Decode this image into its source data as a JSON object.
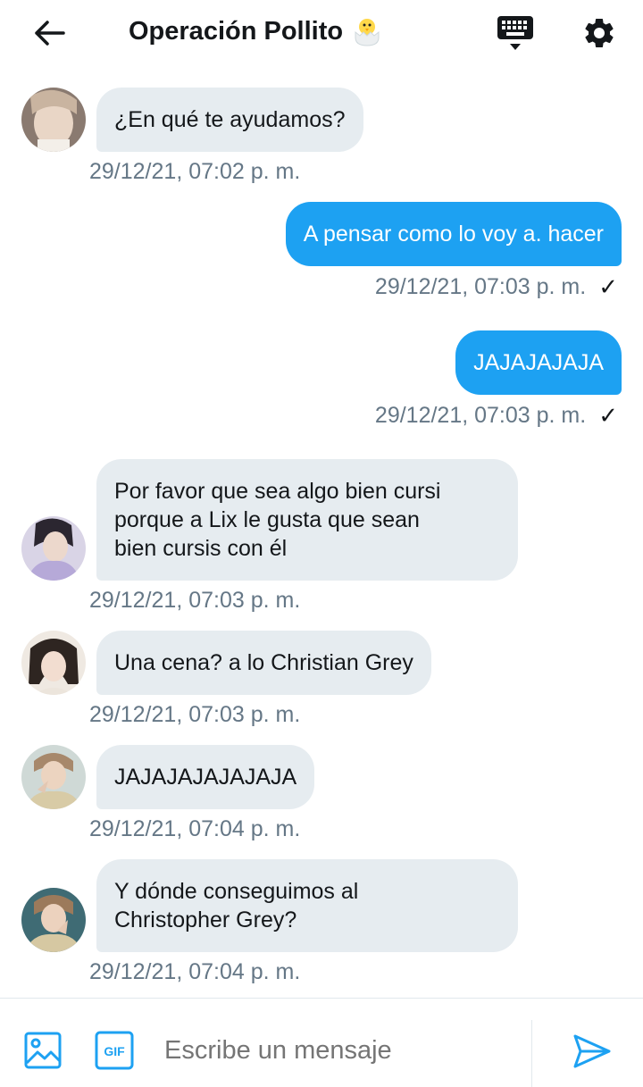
{
  "header": {
    "title": "Operación Pollito",
    "back_icon": "arrow-left-icon",
    "chick_icon": "hatching-chick-emoji",
    "keyboard_icon": "keyboard-icon",
    "settings_icon": "gear-icon"
  },
  "messages": [
    {
      "direction": "in",
      "lines": [
        "¿En qué te ayudamos?"
      ],
      "timestamp": "29/12/21, 07:02 p. m."
    },
    {
      "direction": "out",
      "lines": [
        "A pensar como lo voy a. hacer"
      ],
      "timestamp": "29/12/21, 07:03 p. m.",
      "check": "✓"
    },
    {
      "direction": "out",
      "lines": [
        "JAJAJAJAJA"
      ],
      "timestamp": "29/12/21, 07:03 p. m.",
      "check": "✓"
    },
    {
      "direction": "in",
      "lines": [
        "Por favor que sea algo bien cursi",
        "porque a Lix le gusta que sean",
        "bien cursis con él"
      ],
      "timestamp": "29/12/21, 07:03 p. m."
    },
    {
      "direction": "in",
      "lines": [
        "Una cena? a lo Christian Grey"
      ],
      "timestamp": "29/12/21, 07:03 p. m."
    },
    {
      "direction": "in",
      "lines": [
        "JAJAJAJAJAJAJA"
      ],
      "timestamp": "29/12/21, 07:04 p. m."
    },
    {
      "direction": "in",
      "lines": [
        "Y dónde conseguimos al",
        "Christopher Grey?"
      ],
      "timestamp": "29/12/21, 07:04 p. m."
    }
  ],
  "composer": {
    "placeholder": "Escribe un mensaje",
    "gif_label": "GIF",
    "image_icon": "image-icon",
    "send_icon": "send-icon"
  },
  "colors": {
    "accent": "#1da1f2",
    "bubble_in": "#e6ecf0",
    "timestamp": "#657786"
  }
}
